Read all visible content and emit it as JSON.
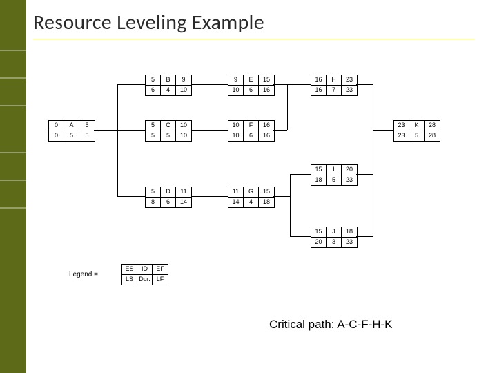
{
  "title": "Resource Leveling Example",
  "critical_path": "Critical path: A-C-F-H-K",
  "legend_word": "Legend =",
  "legend": {
    "top": {
      "es": "ES",
      "id": "ID",
      "ef": "EF"
    },
    "bot": {
      "ls": "LS",
      "dur": "Dur.",
      "lf": "LF"
    }
  },
  "nodes": {
    "A": {
      "es": "0",
      "id": "A",
      "ef": "5",
      "ls": "0",
      "dur": "5",
      "lf": "5"
    },
    "B": {
      "es": "5",
      "id": "B",
      "ef": "9",
      "ls": "6",
      "dur": "4",
      "lf": "10"
    },
    "C": {
      "es": "5",
      "id": "C",
      "ef": "10",
      "ls": "5",
      "dur": "5",
      "lf": "10"
    },
    "D": {
      "es": "5",
      "id": "D",
      "ef": "11",
      "ls": "8",
      "dur": "6",
      "lf": "14"
    },
    "E": {
      "es": "9",
      "id": "E",
      "ef": "15",
      "ls": "10",
      "dur": "6",
      "lf": "16"
    },
    "F": {
      "es": "10",
      "id": "F",
      "ef": "16",
      "ls": "10",
      "dur": "6",
      "lf": "16"
    },
    "G": {
      "es": "11",
      "id": "G",
      "ef": "15",
      "ls": "14",
      "dur": "4",
      "lf": "18"
    },
    "H": {
      "es": "16",
      "id": "H",
      "ef": "23",
      "ls": "16",
      "dur": "7",
      "lf": "23"
    },
    "I": {
      "es": "15",
      "id": "I",
      "ef": "20",
      "ls": "18",
      "dur": "5",
      "lf": "23"
    },
    "J": {
      "es": "15",
      "id": "J",
      "ef": "18",
      "ls": "20",
      "dur": "3",
      "lf": "23"
    },
    "K": {
      "es": "23",
      "id": "K",
      "ef": "28",
      "ls": "23",
      "dur": "5",
      "lf": "28"
    }
  }
}
